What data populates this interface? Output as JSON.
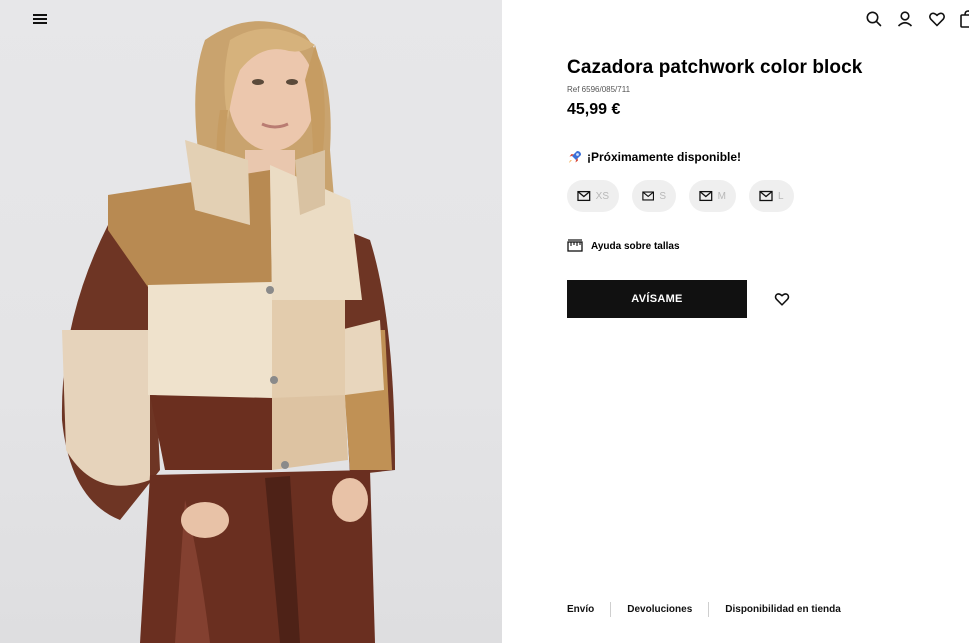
{
  "header": {
    "menu_icon": "hamburger-menu-icon",
    "icons": [
      "search-icon",
      "user-icon",
      "heart-icon",
      "bag-icon"
    ]
  },
  "product": {
    "image_alt": "model-wearing-patchwork-jacket",
    "title": "Cazadora patchwork color block",
    "ref": "Ref 6596/085/711",
    "price": "45,99 €",
    "availability_icon": "rocket-icon",
    "availability_text": "¡Próximamente disponible!",
    "sizes": [
      "XS",
      "S",
      "M",
      "L"
    ],
    "size_help_label": "Ayuda sobre tallas",
    "notify_label": "AVÍSAME"
  },
  "footer": {
    "links": [
      "Envío",
      "Devoluciones",
      "Disponibilidad en tienda"
    ]
  },
  "colors": {
    "primary_button": "#111111",
    "size_chip_bg": "#efefef",
    "size_label_disabled": "#b8b8b8",
    "photo_bg": "#e5e5e7"
  }
}
